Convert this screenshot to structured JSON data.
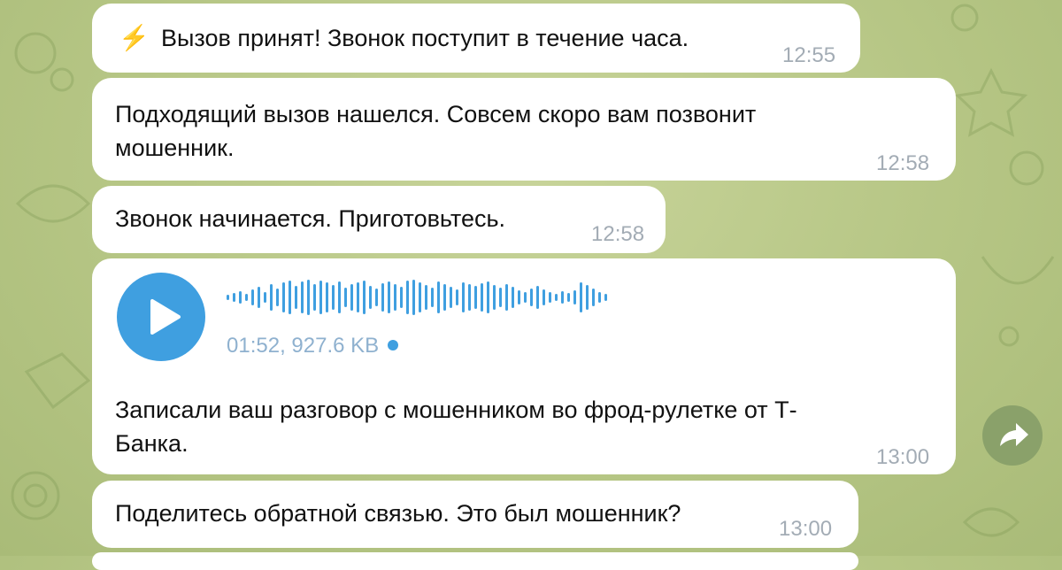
{
  "messages": [
    {
      "icon": "⚡",
      "text": "Вызов принят! Звонок поступит в течение часа.",
      "time": "12:55"
    },
    {
      "line1": "Подходящий вызов нашелся. Совсем скоро вам позвонит",
      "line2": "мошенник.",
      "time": "12:58"
    },
    {
      "text": "Звонок начинается. Приготовьтесь.",
      "time": "12:58"
    },
    {
      "audio": {
        "duration": "01:52",
        "size": "927.6 KB"
      },
      "line1": "Записали ваш разговор с мошенником во фрод-рулетке от Т-",
      "line2": "Банка.",
      "time": "13:00"
    },
    {
      "text": "Поделитесь обратной связью. Это был мошенник?",
      "time": "13:00"
    }
  ],
  "colors": {
    "accent": "#3f9fe0",
    "bubble": "#ffffff",
    "time": "#a3acb5"
  },
  "icons": {
    "lightning": "lightning-icon",
    "play": "play-icon",
    "forward": "forward-arrow-icon"
  }
}
